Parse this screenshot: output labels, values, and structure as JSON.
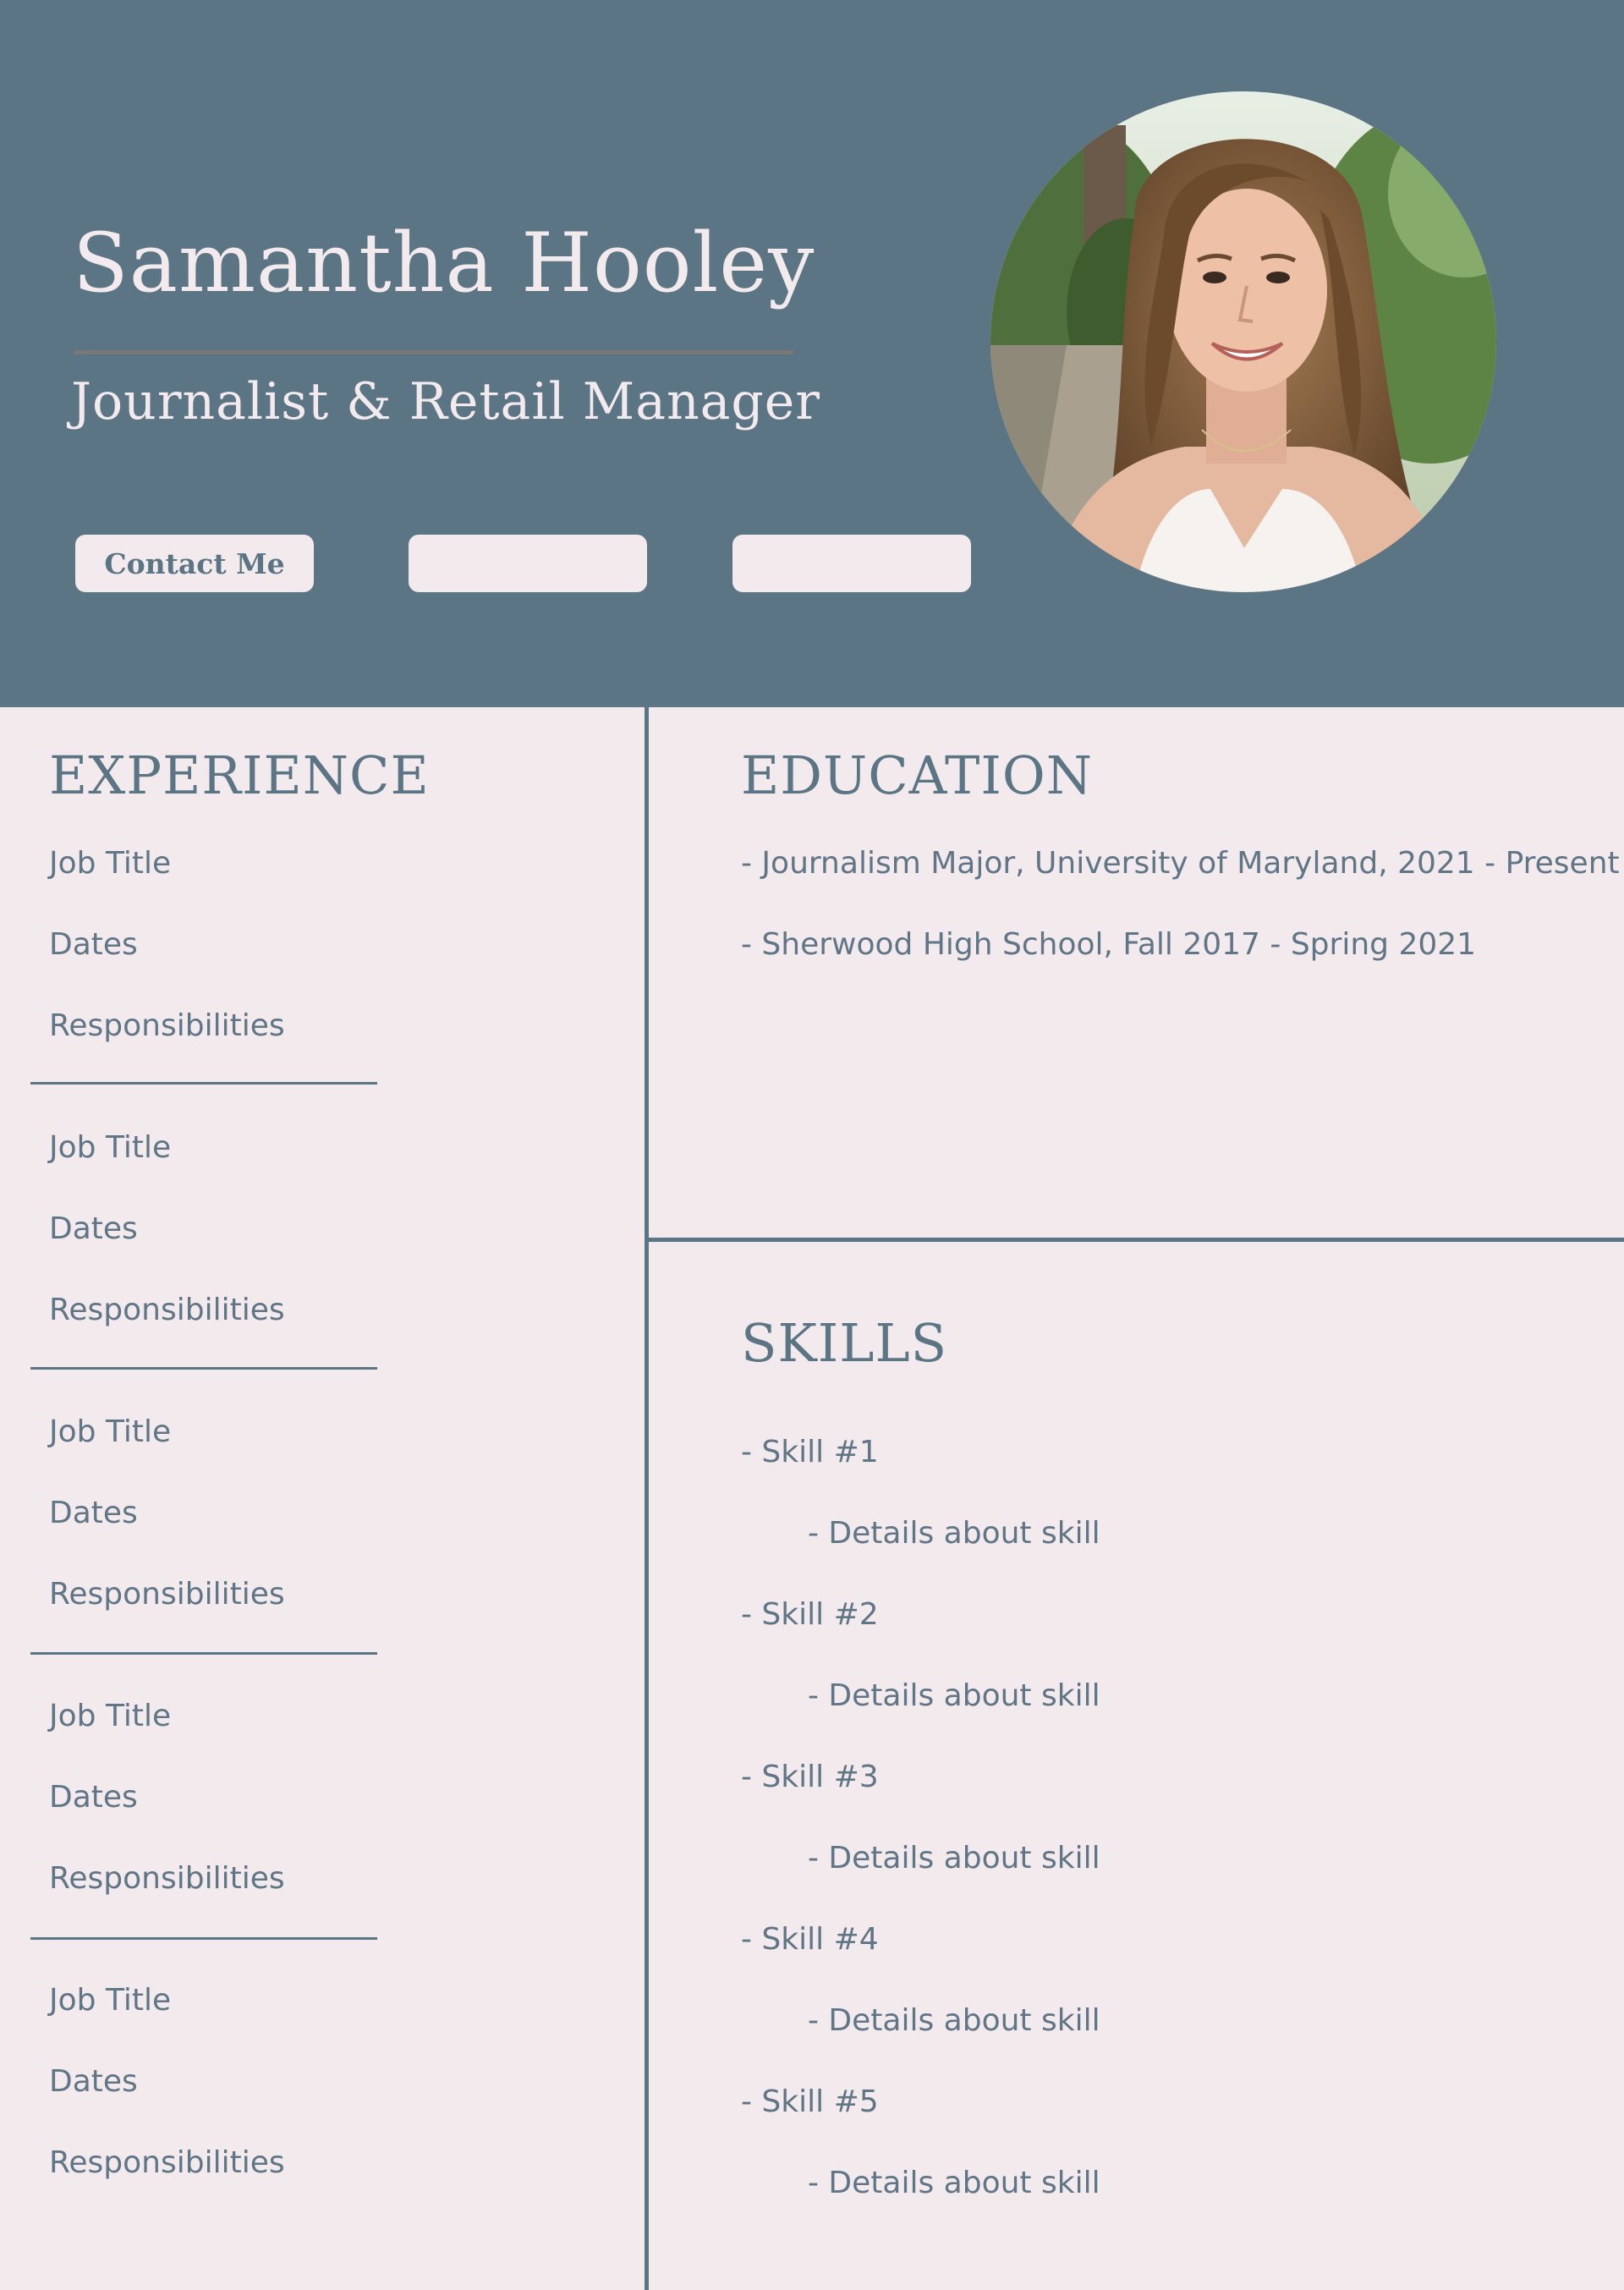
{
  "header": {
    "name": "Samantha Hooley",
    "subtitle": "Journalist & Retail Manager",
    "buttons": [
      "Contact Me",
      "",
      ""
    ]
  },
  "experience": {
    "title": "EXPERIENCE",
    "jobs": [
      {
        "title": "Job Title",
        "dates": "Dates",
        "responsibilities": "Responsibilities"
      },
      {
        "title": "Job Title",
        "dates": "Dates",
        "responsibilities": "Responsibilities"
      },
      {
        "title": "Job Title",
        "dates": "Dates",
        "responsibilities": "Responsibilities"
      },
      {
        "title": "Job Title",
        "dates": "Dates",
        "responsibilities": "Responsibilities"
      },
      {
        "title": "Job Title",
        "dates": "Dates",
        "responsibilities": "Responsibilities"
      }
    ]
  },
  "education": {
    "title": "EDUCATION",
    "items": [
      "- Journalism Major, University of Maryland, 2021 - Present",
      "- Sherwood High School, Fall 2017 - Spring 2021"
    ]
  },
  "skills": {
    "title": "SKILLS",
    "items": [
      {
        "name": "- Skill #1",
        "details": "- Details about skill"
      },
      {
        "name": "- Skill #2",
        "details": "- Details about skill"
      },
      {
        "name": "- Skill #3",
        "details": "- Details about skill"
      },
      {
        "name": "- Skill #4",
        "details": "- Details about skill"
      },
      {
        "name": "- Skill #5",
        "details": "- Details about skill"
      }
    ]
  },
  "colors": {
    "header_bg": "#5b7584",
    "page_bg": "#f3eaed",
    "text": "#607585"
  }
}
